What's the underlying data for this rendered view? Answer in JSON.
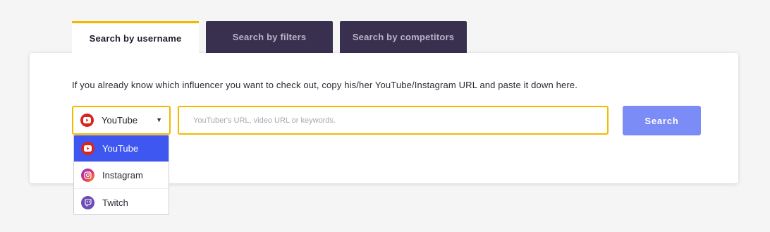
{
  "tabs": [
    {
      "label": "Search by username",
      "active": true
    },
    {
      "label": "Search by filters",
      "active": false
    },
    {
      "label": "Search by competitors",
      "active": false
    }
  ],
  "search": {
    "intro": "If you already know which influencer you want to check out, copy his/her YouTube/Instagram URL and paste it down here.",
    "selected_platform": "YouTube",
    "placeholder": "YouTuber's URL, video URL or keywords.",
    "value": "",
    "button_label": "Search"
  },
  "dropdown": {
    "options": [
      {
        "label": "YouTube",
        "icon": "youtube-icon",
        "selected": true
      },
      {
        "label": "Instagram",
        "icon": "instagram-icon",
        "selected": false
      },
      {
        "label": "Twitch",
        "icon": "twitch-icon",
        "selected": false
      }
    ]
  },
  "colors": {
    "accent": "#f5b800",
    "tab_inactive_bg": "#39304f",
    "button_bg": "#7b8cf7",
    "selected_option_bg": "#3e57f0",
    "youtube": "#d8251c",
    "twitch": "#6c4db5"
  }
}
